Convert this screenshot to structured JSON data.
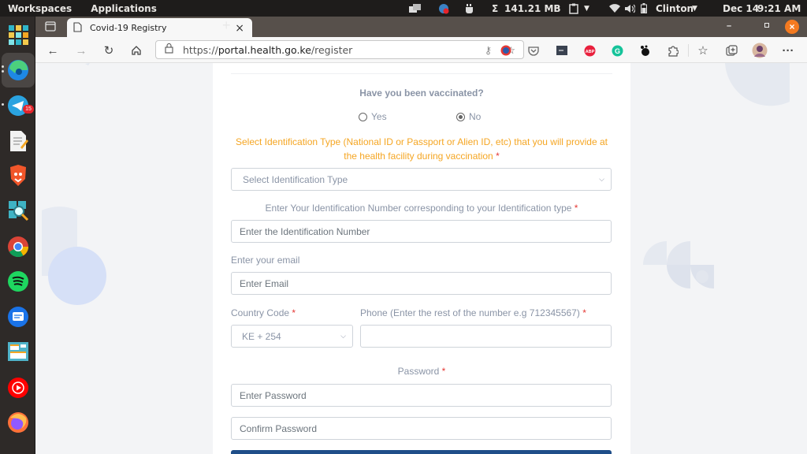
{
  "system_bar": {
    "workspaces": "Workspaces",
    "applications": "Applications",
    "memory": "141.21 MB",
    "memory_icon": "sigma-icon",
    "user": "Clinton",
    "date": "Dec 14",
    "time": "9:21 AM"
  },
  "dock": {
    "items": [
      {
        "name": "app-grid",
        "icon": "app-grid-icon"
      },
      {
        "name": "edge",
        "icon": "edge-icon",
        "active": true
      },
      {
        "name": "telegram",
        "icon": "telegram-icon",
        "badge": "15"
      },
      {
        "name": "text-editor",
        "icon": "text-editor-icon"
      },
      {
        "name": "brave",
        "icon": "brave-icon"
      },
      {
        "name": "image-viewer",
        "icon": "search-image-icon"
      },
      {
        "name": "chrome",
        "icon": "chrome-icon"
      },
      {
        "name": "spotify",
        "icon": "spotify-icon"
      },
      {
        "name": "messages",
        "icon": "messages-icon"
      },
      {
        "name": "layout-app",
        "icon": "layout-icon"
      },
      {
        "name": "youtube-music",
        "icon": "youtube-music-icon"
      },
      {
        "name": "firefox",
        "icon": "firefox-icon"
      }
    ]
  },
  "browser": {
    "tab_title": "Covid-19 Registry",
    "url_scheme": "https://",
    "url_host": "portal.health.go.ke",
    "url_path": "/register",
    "new_tab": "+",
    "close_tab": "×"
  },
  "form": {
    "vaccinated_question": "Have you been vaccinated?",
    "vaccinated_options": [
      {
        "label": "Yes",
        "checked": false
      },
      {
        "label": "No",
        "checked": true
      }
    ],
    "id_type_label_line1": "Select Identification Type (National ID or Passport or Alien ID, etc) that you will provide at",
    "id_type_label_line2": "the health facility during vaccination",
    "id_type_placeholder": "Select Identification Type",
    "id_number_label": "Enter Your Identification Number corresponding to your Identification type",
    "id_number_placeholder": "Enter the Identification Number",
    "email_label": "Enter your email",
    "email_placeholder": "Enter Email",
    "country_code_label": "Country Code",
    "country_code_value": "KE + 254",
    "phone_label": "Phone (Enter the rest of the number e.g 712345567)",
    "phone_value": "",
    "password_label": "Password",
    "password_placeholder": "Enter Password",
    "confirm_password_placeholder": "Confirm Password",
    "required_mark": "*"
  },
  "colors": {
    "accent_orange": "#f5a623",
    "required_red": "#e53935",
    "submit_blue": "#1f4e89"
  }
}
